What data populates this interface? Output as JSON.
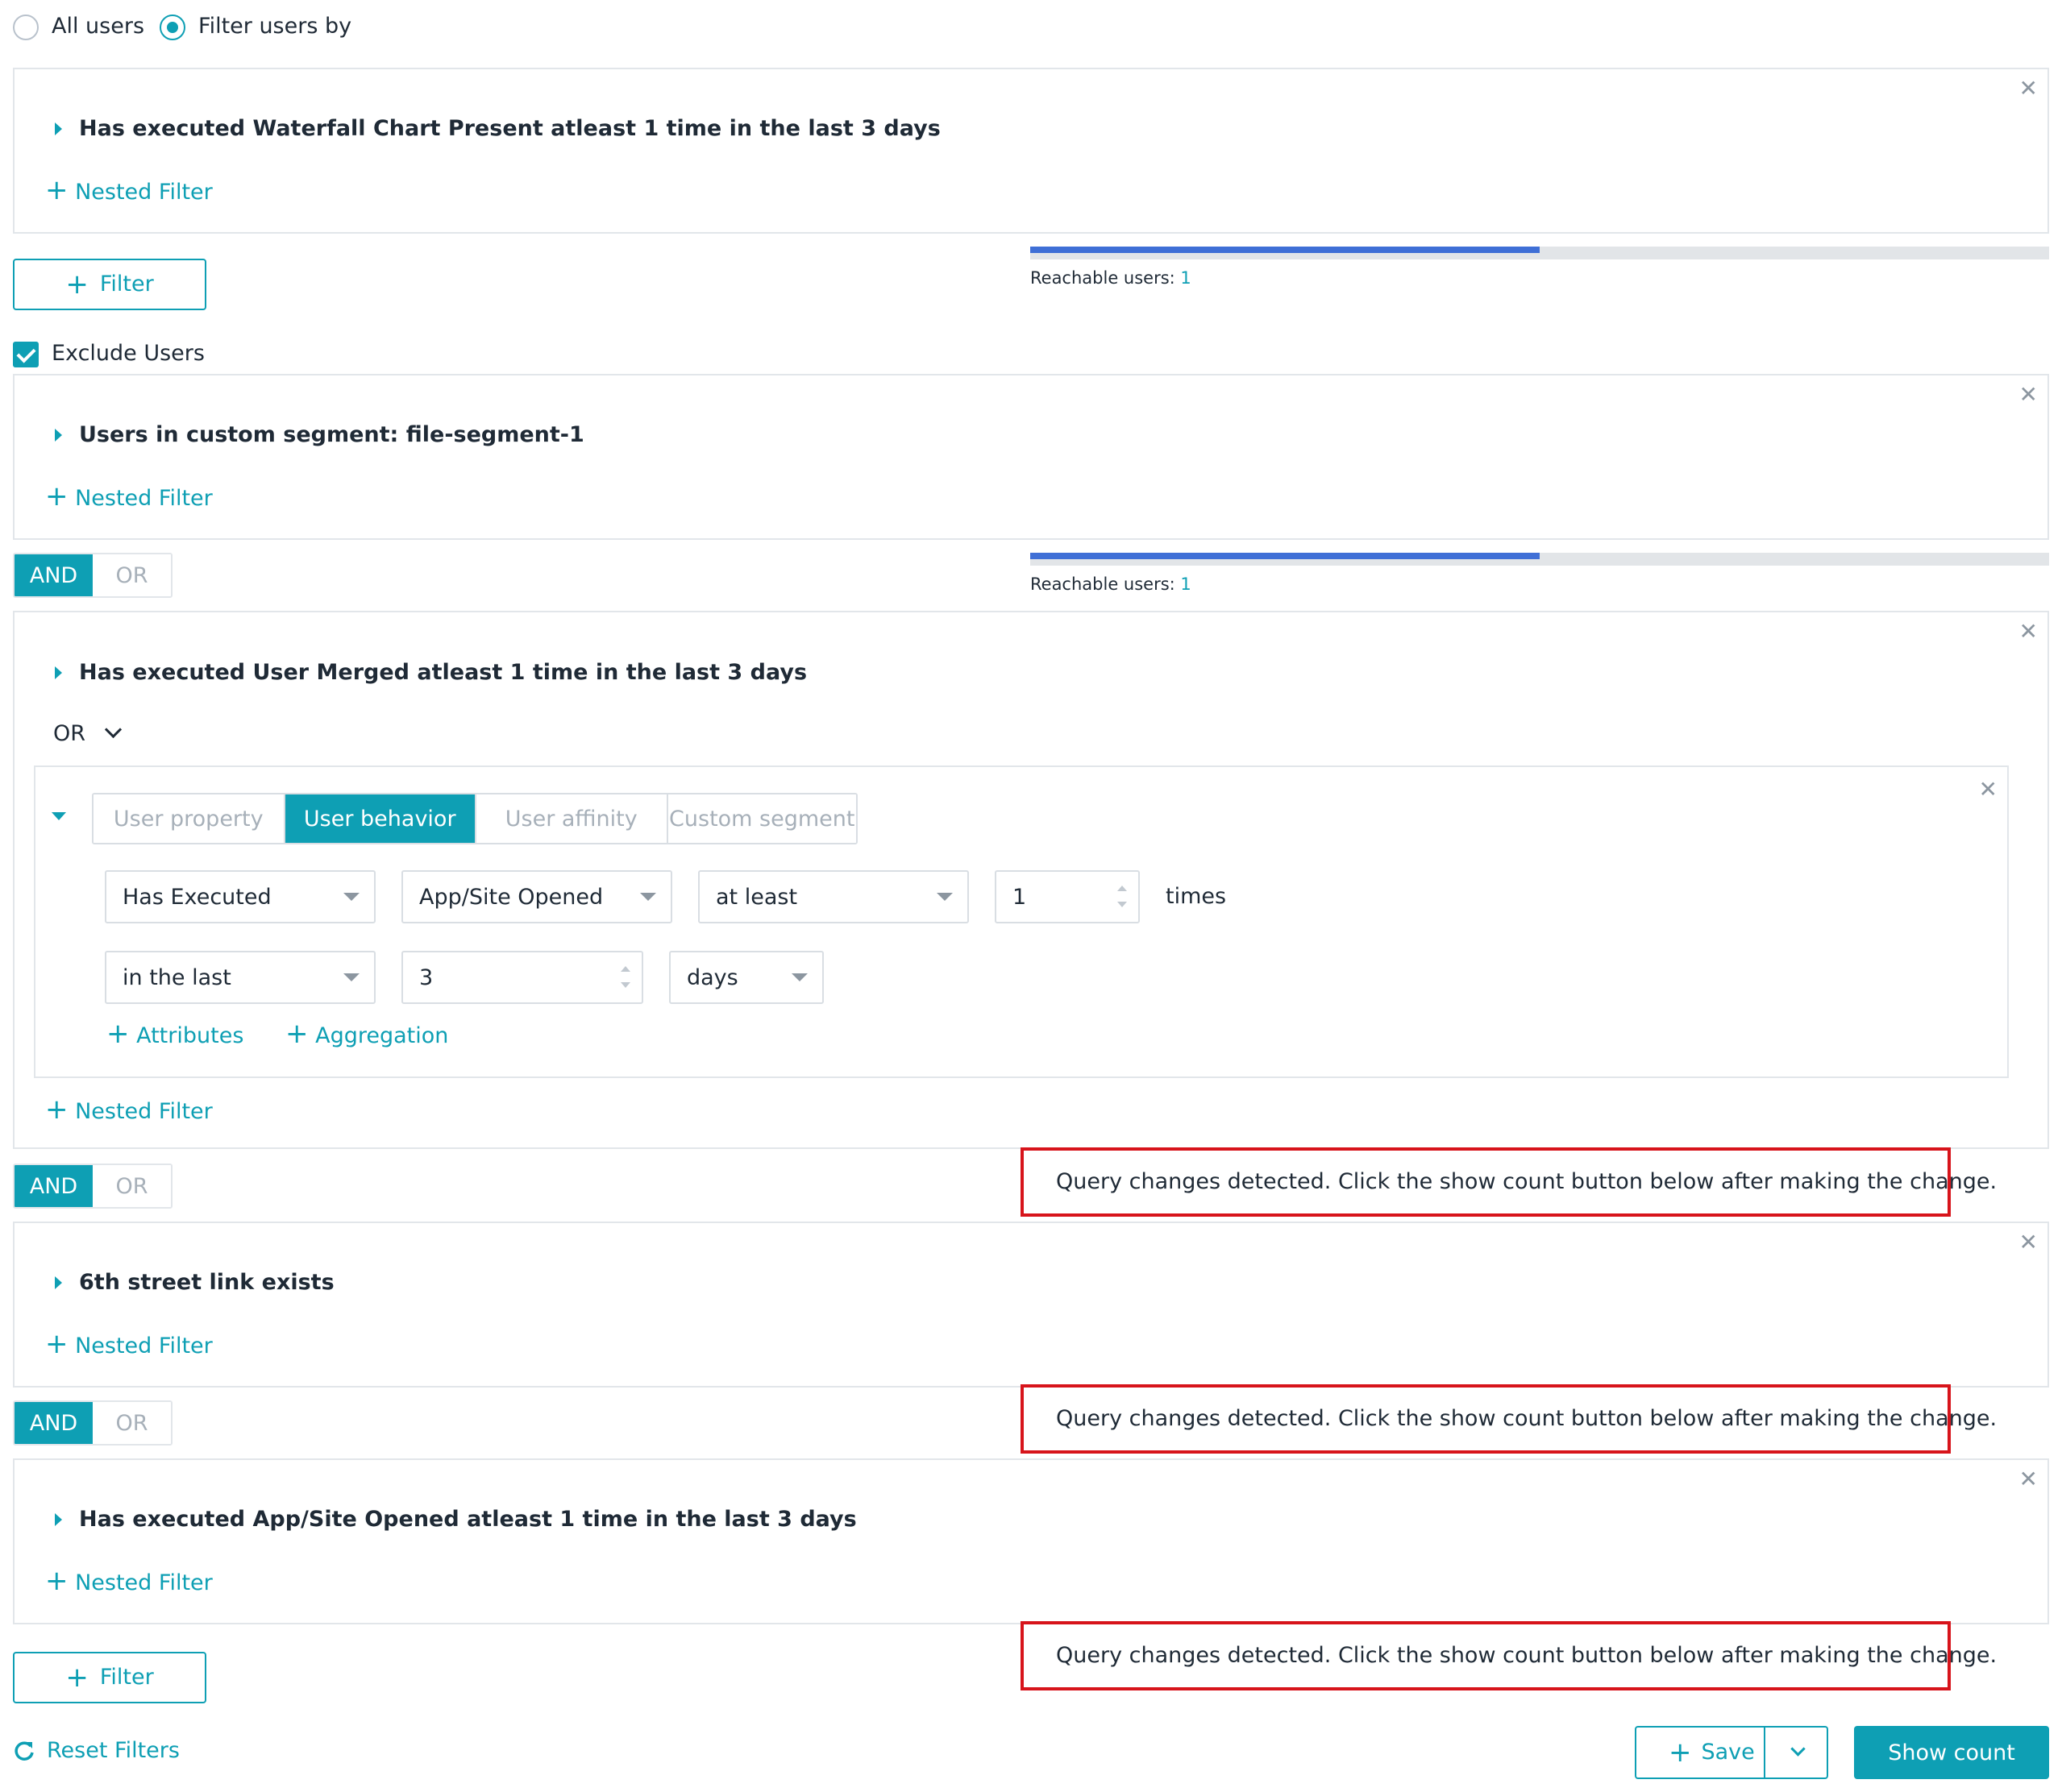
{
  "audience": {
    "all_users_label": "All users",
    "filter_users_by_label": "Filter users by",
    "selected": "Filter users by"
  },
  "filters": [
    {
      "title": "Has executed Waterfall Chart Present atleast 1 time in the last 3 days",
      "nested_label": "Nested Filter"
    },
    {
      "title": "Users in custom segment: file-segment-1",
      "nested_label": "Nested Filter"
    },
    {
      "title": "Has executed User Merged atleast 1 time in the last 3 days",
      "nested_label": "Nested Filter"
    },
    {
      "title": "6th street link exists",
      "nested_label": "Nested Filter"
    },
    {
      "title": "Has executed App/Site Opened atleast 1 time in the last 3 days",
      "nested_label": "Nested Filter"
    }
  ],
  "add_filter_label": "Filter",
  "exclude_users": {
    "label": "Exclude Users",
    "checked": true
  },
  "reachable": [
    {
      "label": "Reachable users: ",
      "count": "1",
      "fill_fraction": 0.5
    },
    {
      "label": "Reachable users: ",
      "count": "1",
      "fill_fraction": 0.5
    }
  ],
  "logic": {
    "and_label": "AND",
    "or_label": "OR",
    "selected": "AND"
  },
  "nested_operator": {
    "label": "OR"
  },
  "editor": {
    "tabs": [
      "User property",
      "User behavior",
      "User affinity",
      "Custom segment"
    ],
    "selected_tab": "User behavior",
    "action_select": "Has Executed",
    "event_select": "App/Site Opened",
    "comparison_select": "at least",
    "count_value": "1",
    "times_label": "times",
    "time_select": "in the last",
    "period_value": "3",
    "unit_select": "days",
    "attributes_label": "Attributes",
    "aggregation_label": "Aggregation"
  },
  "warning_text": "Query changes detected. Click the show count button below after making the change.",
  "footer": {
    "reset_label": "Reset Filters",
    "save_label": "Save",
    "show_count_label": "Show count"
  },
  "colors": {
    "accent": "#0e9fb4",
    "warning_border": "#d7141b",
    "warning_icon": "#f0a030",
    "bar": "#3f6fd6"
  }
}
